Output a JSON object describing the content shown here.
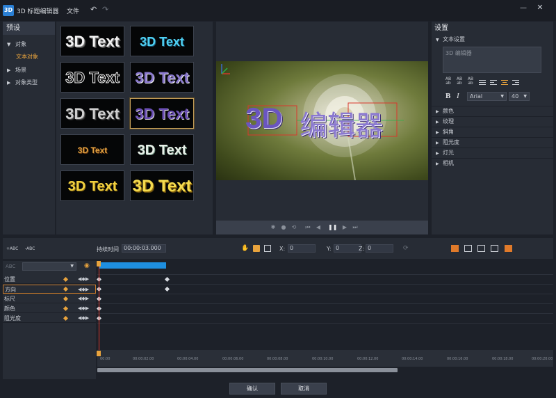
{
  "window": {
    "app_icon": "3D",
    "title": "3D 标题编辑器",
    "menu_file": "文件",
    "undo_icon": "↶",
    "redo_icon": "↷",
    "minimize_icon": "—",
    "close_icon": "✕"
  },
  "presets": {
    "header": "预设",
    "tree": [
      {
        "label": "对象",
        "arrow": "▼"
      },
      {
        "label": "文本对象",
        "arrow": ""
      },
      {
        "label": "场景",
        "arrow": "▶"
      },
      {
        "label": "对象类型",
        "arrow": "▶"
      }
    ],
    "thumbs": [
      {
        "label": "3D Text"
      },
      {
        "label": "3D Text"
      },
      {
        "label": "3D Text"
      },
      {
        "label": "3D Text"
      },
      {
        "label": "3D Text"
      },
      {
        "label": "3D Text"
      },
      {
        "label": "3D Text"
      },
      {
        "label": "3D Text"
      },
      {
        "label": "3D Text"
      },
      {
        "label": "3D Text"
      }
    ]
  },
  "preview": {
    "title_3d": "3D",
    "title_cn": "编辑器"
  },
  "settings": {
    "header": "设置",
    "text_section": "文本设置",
    "text_value": "3D 编辑器",
    "fmt_labels": [
      "AB\nab",
      "AB\nab",
      "AB\nab"
    ],
    "bold": "B",
    "italic": "I",
    "font": "Arial",
    "size": "40",
    "sections": [
      "颜色",
      "纹理",
      "斜角",
      "阻光度",
      "灯光",
      "相机"
    ]
  },
  "timeline": {
    "add_abc": "+ABC",
    "remove_abc": "-ABC",
    "duration_label": "持续时间",
    "duration_value": "00:00:03.000",
    "x_label": "X:",
    "x_value": "0",
    "y_label": "Y:",
    "y_value": "0",
    "z_label": "Z:",
    "z_value": "0",
    "layer_label": "ABC",
    "tracks": [
      {
        "label": "位置"
      },
      {
        "label": "方向"
      },
      {
        "label": "标尺"
      },
      {
        "label": "颜色"
      },
      {
        "label": "阻光度"
      }
    ],
    "ruler": [
      "00:00",
      "00:00:02.00",
      "00:00:04.00",
      "00:00:06.00",
      "00:00:08.00",
      "00:00:10.00",
      "00:00:12.00",
      "00:00:14.00",
      "00:00:16.00",
      "00:00:18.00",
      "00:00:20.00"
    ]
  },
  "buttons": {
    "ok": "确认",
    "cancel": "取消"
  },
  "colors": {
    "accent": "#e8a33d",
    "clip": "#1e8fe0",
    "playhead": "#d9382c"
  }
}
